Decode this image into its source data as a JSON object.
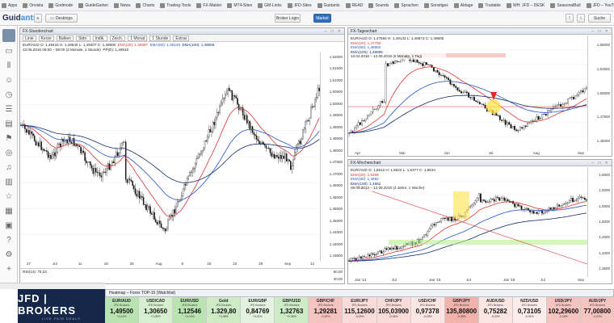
{
  "bookmarks": [
    "Apps",
    "Onvista",
    "Godmode",
    "GuideGarten",
    "News",
    "Charts",
    "Trading-Tools",
    "FX-Makler",
    "MT4-Sites",
    "GM-Links",
    "JFD-Sites",
    "Guidants",
    "READ",
    "Sounds",
    "Sprachen",
    "Sonstiges",
    "Ablage",
    "Tradable",
    "WH: JFD – DESK",
    "SeasonalBull",
    "JFD – YouTube",
    "Live – YouTube"
  ],
  "toolbar": {
    "brand_a": "Guid",
    "brand_b": "ants",
    "desktops_label": "Desktops",
    "broker_login_label": "Broker Login",
    "market_label": "Market",
    "search_label": "Suche"
  },
  "hourly": {
    "title": "FX-Stundenchart",
    "tools": [
      "Linie",
      "Kerze",
      "Balken",
      "Stdn.",
      "Indik.",
      "Zeich.",
      "1 Monat",
      "1 Stunde",
      "Extras"
    ],
    "legend_line1": "EUR/AUD   O: 1,49416  H: 1,49640  L: 1,49407  C: 1,49500",
    "ema20": "EMA(20): 1,48697",
    "ema50": "EMA(50): 1,48149",
    "ema100": "EMA(100): 1,48058",
    "range": "23.06.2016 06:00 – 09:00 (3 Monate, 1 Stunde)",
    "pp": "PP(D): 1,49915",
    "yticks": [
      "1,52000",
      "1,51500",
      "1,51000",
      "1,50500",
      "1,50000",
      "1,49500",
      "1,49000",
      "1,48500",
      "1,48000",
      "1,47500",
      "1,47000",
      "1,46500",
      "1,46000",
      "1,45500",
      "1,45000",
      "1,44500",
      "1,44000",
      "1,43500"
    ],
    "xticks": [
      "27",
      "Jul",
      "11",
      "18",
      "25",
      "Aug",
      "8",
      "15",
      "22",
      "29",
      "Sep",
      "12"
    ],
    "rsi_label": "RSI(14): 70,23",
    "rsi_levels": [
      "60,00",
      "40,00"
    ]
  },
  "daily": {
    "title": "FX-Tageschart",
    "legend_line1": "EUR/AUD   O: 1,47584  H: 1,49133  L: 1,46873  C: 1,49505",
    "ema20": "EMA(20): 1,47790",
    "ema50": "EMA(50): 1,48682",
    "ema100": "EMA(100): 1,48995",
    "range": "13.03.2016 – 12.09.2016 (6 Monate, 1 Tag)",
    "fib_labels": [
      "1,56470 (0,00%)",
      "1,52844 (38,20%)",
      "1,50413 (50,00%)",
      "1,49502 (61,80%)",
      "1,44282 (100,00%)"
    ],
    "yticks": [
      "1,55000",
      "1,52500",
      "1,50000",
      "1,47500",
      "1,45000"
    ],
    "xticks": [
      "Apr",
      "Mai",
      "Jun",
      "Jul",
      "Aug",
      "Sep"
    ],
    "date_marker": "24.07.2016"
  },
  "weekly": {
    "title": "FX-Wochenchart",
    "legend_line1": "EUR/AUD   O: 1,5512  H: 1,5622  L: 1,5377  C: 1,5634",
    "ema20": "EMA(20): 1,5298",
    "ema50": "EMA(50): 1,4882",
    "ema100": "EMA(100): 1,4652",
    "range": "09.09.2013 – 12.09.2016 (3 Jahre, 1 Woche)",
    "yticks": [
      "1,6500",
      "1,6000",
      "1,5500",
      "1,5000",
      "1,4500",
      "1,4000",
      "1,3500"
    ],
    "xticks": [
      "Jan '14",
      "Jul",
      "Jan '15",
      "Jul",
      "Jan '16",
      "Jul",
      "Sep"
    ],
    "date_marker": "12.10.2015",
    "price_badges": [
      "1,5147",
      "1,4843"
    ]
  },
  "heatmap": {
    "title": "Heatmap – Forex TOP-15 (Watchlist)",
    "cells": [
      {
        "sym": "EUR/AUD",
        "sub": "JFD Brokers",
        "val": "1,49500",
        "chg": "+0,12%",
        "color": "#b9e3b0"
      },
      {
        "sym": "USD/CAD",
        "sub": "JFD Brokers",
        "val": "1,30650",
        "chg": "+0,05%",
        "color": "#d6f0cf"
      },
      {
        "sym": "EUR/USD",
        "sub": "JFD Brokers",
        "val": "1,12546",
        "chg": "+0,14%",
        "color": "#b9e3b0"
      },
      {
        "sym": "Gold",
        "sub": "JFD Brokers",
        "val": "1.329,80",
        "chg": "+0,08%",
        "color": "#cdebc5"
      },
      {
        "sym": "EUR/GBP",
        "sub": "JFD Brokers",
        "val": "0,84769",
        "chg": "+0,01%",
        "color": "#e4f3df"
      },
      {
        "sym": "GBP/USD",
        "sub": "JFD Brokers",
        "val": "1,32763",
        "chg": "+0,06%",
        "color": "#cdebc5"
      },
      {
        "sym": "GBP/CHF",
        "sub": "JFD Brokers",
        "val": "1,29281",
        "chg": "-0,22%",
        "color": "#f6c4c0"
      },
      {
        "sym": "EUR/JPY",
        "sub": "JFD Brokers",
        "val": "115,12600",
        "chg": "-0,05%",
        "color": "#f9dcd8"
      },
      {
        "sym": "CHF/JPY",
        "sub": "JFD Brokers",
        "val": "105,03900",
        "chg": "-0,06%",
        "color": "#f9dcd8"
      },
      {
        "sym": "USD/CHF",
        "sub": "JFD Brokers",
        "val": "0,97378",
        "chg": "-0,03%",
        "color": "#fbe6e3"
      },
      {
        "sym": "GBP/JPY",
        "sub": "JFD Brokers",
        "val": "135,80800",
        "chg": "-0,25%",
        "color": "#f3b3ad"
      },
      {
        "sym": "AUD/USD",
        "sub": "JFD Brokers",
        "val": "0,75282",
        "chg": "-0,02%",
        "color": "#fbe6e3"
      },
      {
        "sym": "NZD/USD",
        "sub": "JFD Brokers",
        "val": "0,73105",
        "chg": "-0,01%",
        "color": "#fcecea"
      },
      {
        "sym": "USD/JPY",
        "sub": "JFD Brokers",
        "val": "102,29600",
        "chg": "-0,18%",
        "color": "#f6c4c0"
      },
      {
        "sym": "AUD/JPY",
        "sub": "JFD Brokers",
        "val": "77,00800",
        "chg": "-0,20%",
        "color": "#f6c4c0"
      }
    ]
  },
  "jfd": {
    "name": "JFD | BROKERS",
    "tagline": "LIVE FAIR DEALS"
  }
}
